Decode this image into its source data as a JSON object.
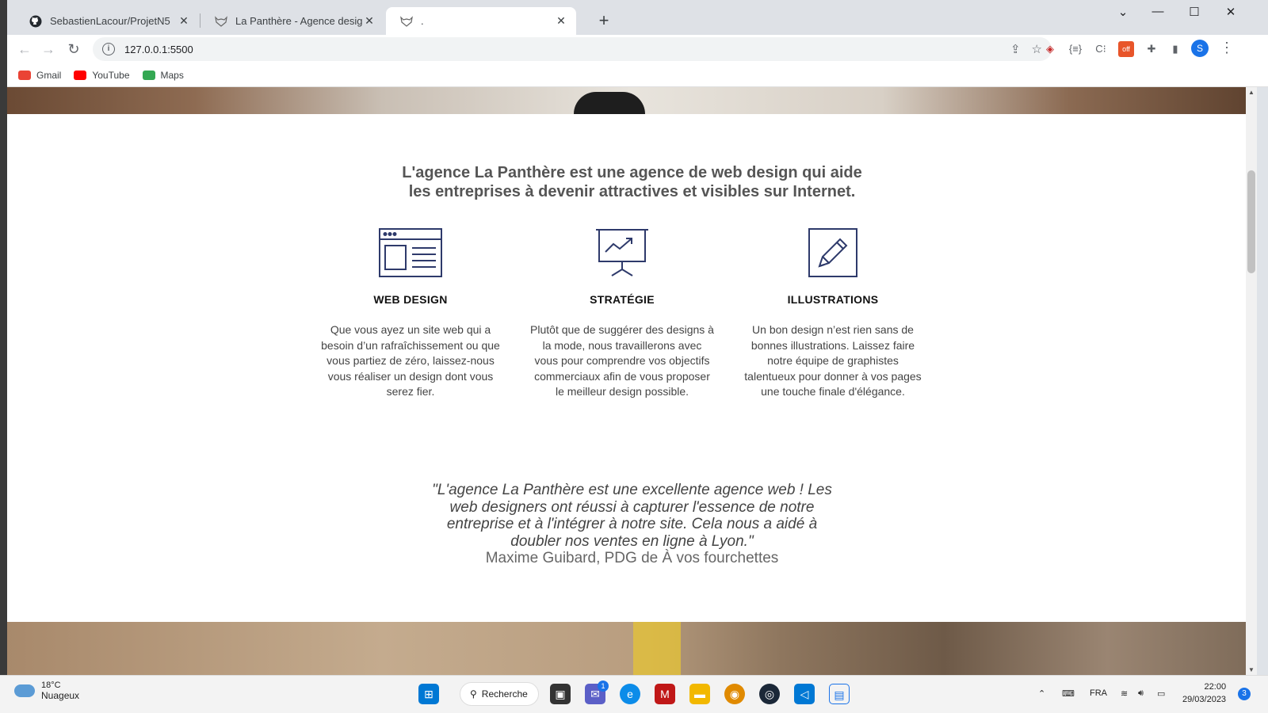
{
  "browser": {
    "tabs": [
      {
        "title": "SebastienLacour/ProjetN5",
        "icon": "github-icon"
      },
      {
        "title": "La Panthère - Agence design",
        "icon": "panther-icon"
      },
      {
        "title": ".",
        "icon": "panther-icon"
      }
    ],
    "url": "127.0.0.1:5500",
    "bookmarks": [
      {
        "label": "Gmail",
        "color": "#ea4335"
      },
      {
        "label": "YouTube",
        "color": "#ff0000"
      },
      {
        "label": "Maps",
        "color": "#34a853"
      }
    ],
    "profile_initial": "S"
  },
  "page": {
    "intro": [
      "L'agence La Panthère est une agence de web design qui aide",
      "les entreprises à devenir attractives et visibles sur Internet."
    ],
    "services": [
      {
        "title": "WEB DESIGN",
        "icon": "browser-window-icon",
        "text": "Que vous ayez un site web qui a besoin d’un rafraîchissement ou que vous partiez de zéro, laissez-nous vous réaliser un design dont vous serez fier."
      },
      {
        "title": "STRATÉGIE",
        "icon": "presentation-chart-icon",
        "text": "Plutôt que de suggérer des designs à la mode, nous travaillerons avec vous pour comprendre vos objectifs commerciaux afin de vous proposer le meilleur design possible."
      },
      {
        "title": "ILLUSTRATIONS",
        "icon": "pencil-square-icon",
        "text": "Un bon design n’est rien sans de bonnes illustrations. Laissez faire notre équipe de graphistes talentueux pour donner à vos pages une touche finale d'élégance."
      }
    ],
    "testimonial": {
      "lines": [
        "\"L'agence La Panthère est une excellente agence web ! Les",
        "web designers ont réussi à capturer l'essence de notre",
        "entreprise et à l'intégrer à notre site. Cela nous a aidé à",
        "doubler nos ventes en ligne à Lyon.\""
      ],
      "author": "Maxime Guibard, PDG de À vos fourchettes"
    },
    "accent_color": "#2e3a6b"
  },
  "taskbar": {
    "weather_temp": "18°C",
    "weather_desc": "Nuageux",
    "search_label": "Recherche",
    "teams_badge": "1",
    "language": "FRA",
    "time": "22:00",
    "date": "29/03/2023",
    "notifications": "3"
  }
}
